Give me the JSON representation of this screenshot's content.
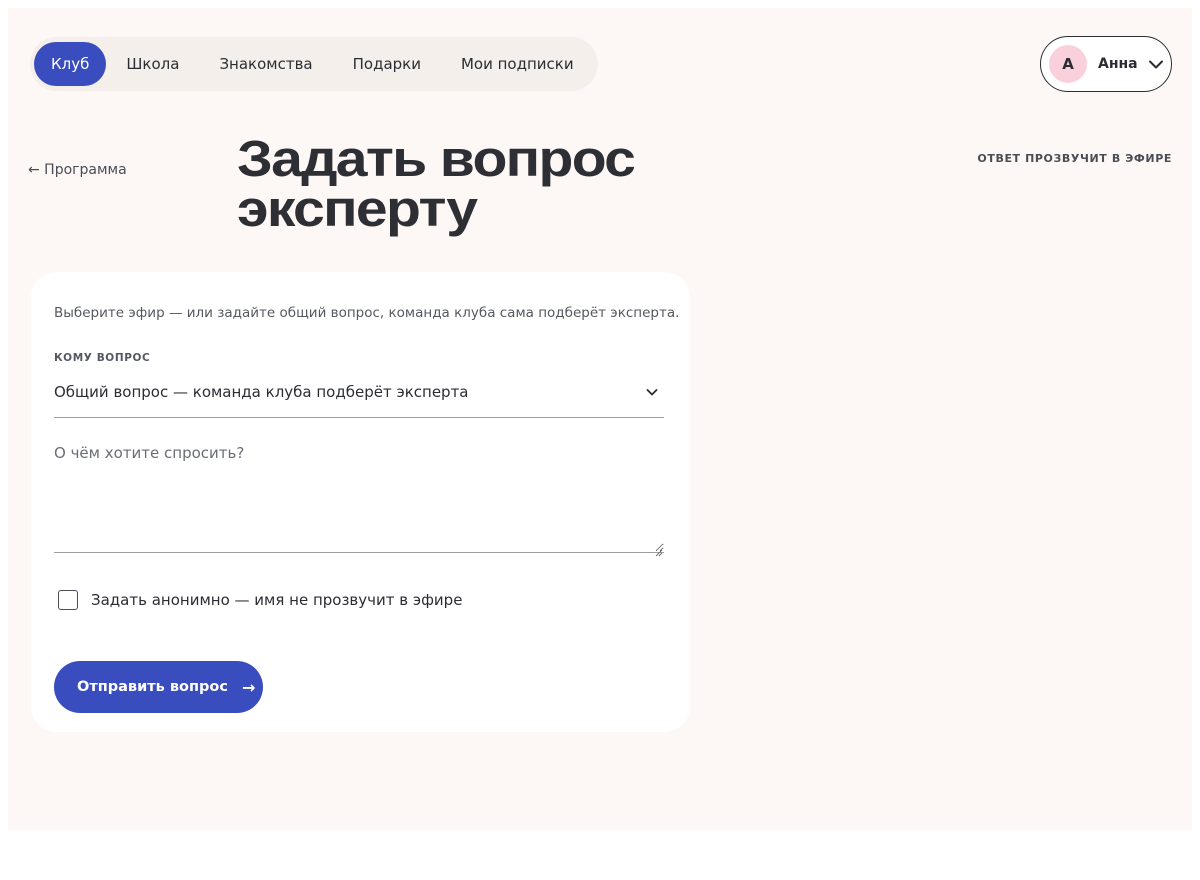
{
  "nav": {
    "items": [
      {
        "label": "Клуб",
        "active": true
      },
      {
        "label": "Школа"
      },
      {
        "label": "Знакомства"
      },
      {
        "label": "Подарки"
      },
      {
        "label": "Мои подписки"
      }
    ]
  },
  "user": {
    "initial": "А",
    "name": "Анна",
    "avatar_color": "#fbd0dd"
  },
  "header": {
    "back_link": "← Программа",
    "title": "Задать вопрос эксперту",
    "aside_note": "ОТВЕТ ПРОЗВУЧИТ В ЭФИРЕ"
  },
  "form": {
    "intro": "Выберите эфир — или задайте общий вопрос, команда клуба сама подберёт эксперта.",
    "recipient_label": "КОМУ ВОПРОС",
    "recipient_value": "Общий вопрос — команда клуба подберёт эксперта",
    "question_placeholder": "О чём хотите спросить?",
    "anonymous_label": "Задать анонимно — имя не прозвучит в эфире",
    "anonymous_checked": false,
    "submit_label": "Отправить вопрос",
    "submit_arrow": "→"
  },
  "colors": {
    "accent": "#3a4dbf",
    "page_bg": "#fdf8f6",
    "card_bg": "#ffffff",
    "text": "#2b2d33"
  }
}
